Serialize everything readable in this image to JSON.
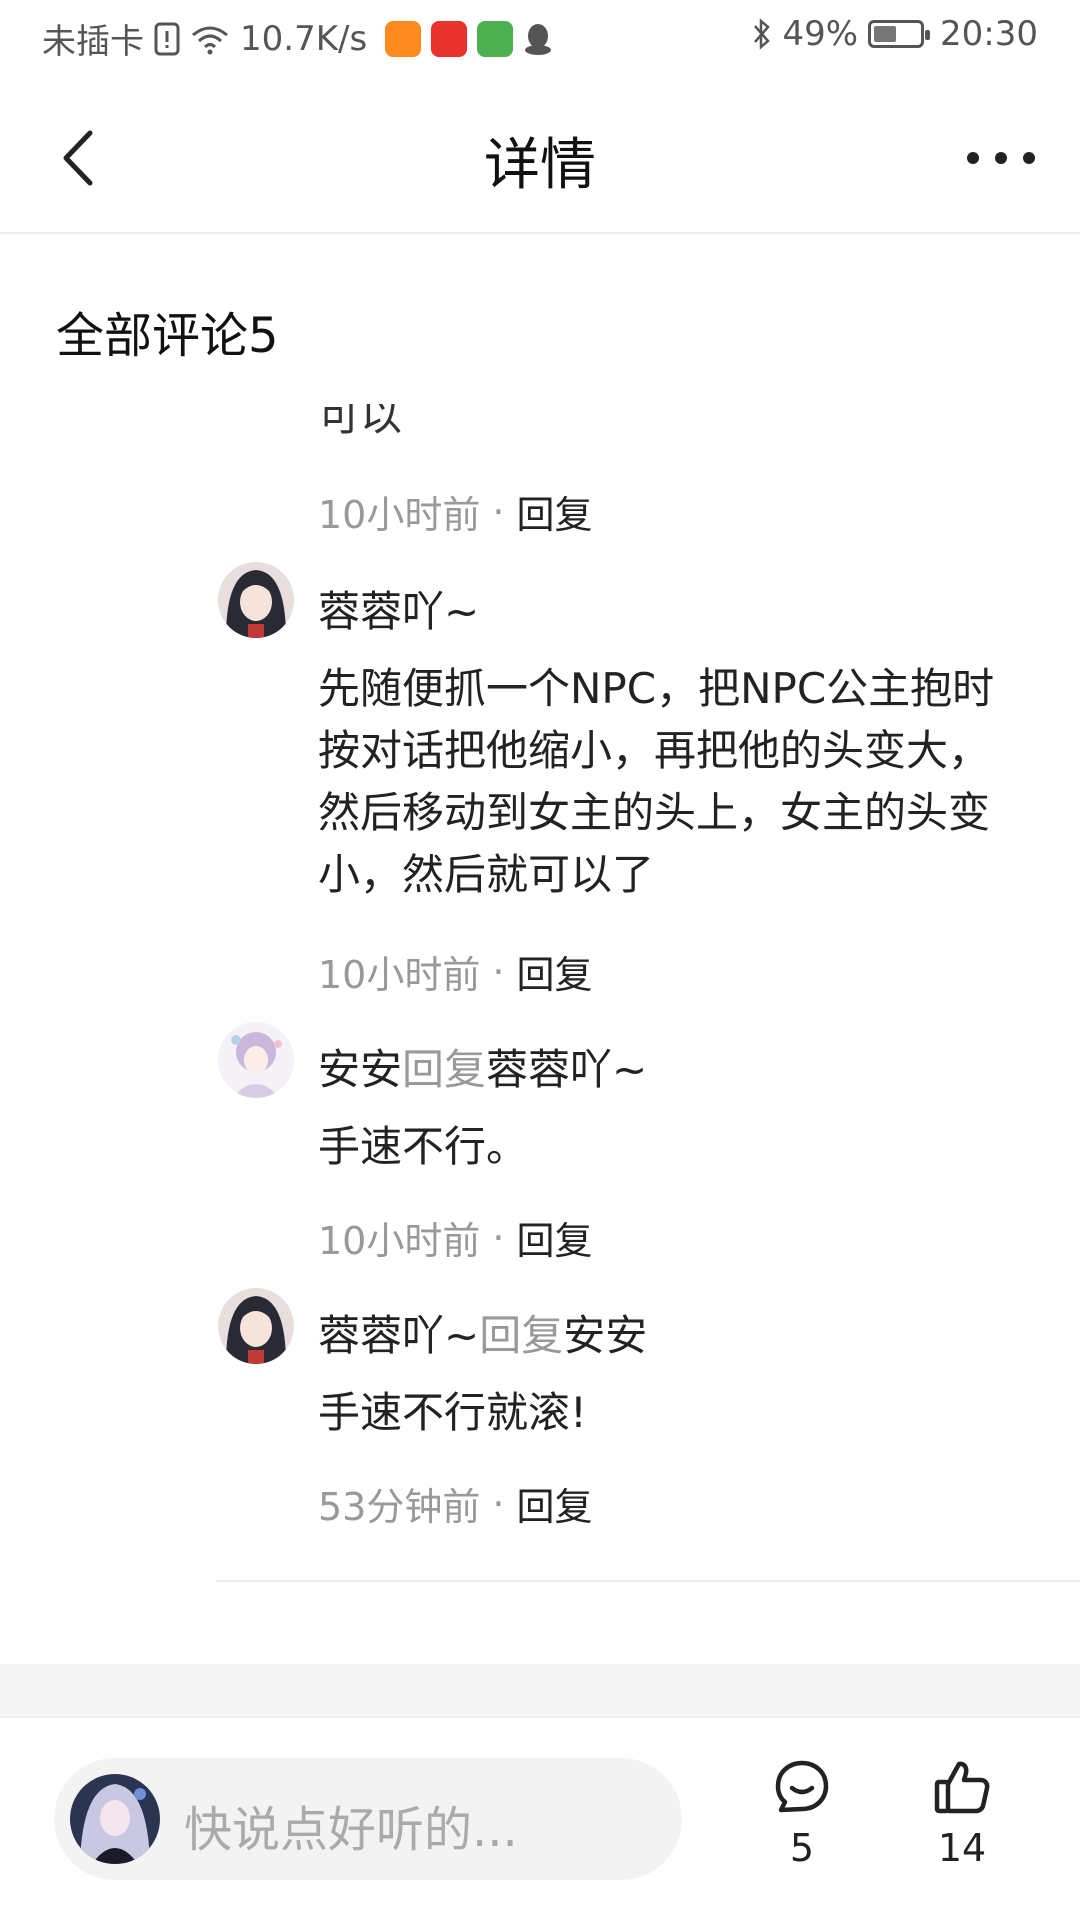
{
  "status_bar": {
    "carrier": "未插卡",
    "net_speed": "10.7K/s",
    "battery": "49%",
    "battery_level": 0.49,
    "time": "20:30"
  },
  "nav": {
    "title": "详情"
  },
  "comments_section": {
    "title": "全部评论5"
  },
  "partial_comment": {
    "text": "可以",
    "time": "10小时前",
    "reply_label": "回复"
  },
  "replies": [
    {
      "user": "蓉蓉吖~",
      "text": "先随便抓一个NPC，把NPC公主抱时按对话把他缩小，再把他的头变大，然后移动到女主的头上，女主的头变小，然后就可以了",
      "time": "10小时前",
      "reply_label": "回复"
    },
    {
      "user": "安安",
      "reply_word": "回复",
      "reply_to": "蓉蓉吖~",
      "text": "手速不行。",
      "time": "10小时前",
      "reply_label": "回复"
    },
    {
      "user": "蓉蓉吖~",
      "reply_word": "回复",
      "reply_to": "安安",
      "text": "手速不行就滚!",
      "time": "53分钟前",
      "reply_label": "回复"
    }
  ],
  "bottom_bar": {
    "placeholder": "快说点好听的...",
    "comment_count": "5",
    "like_count": "14"
  },
  "colors": {
    "text_primary": "#222222",
    "text_secondary": "#999999",
    "input_bg": "#f3f3f3"
  }
}
